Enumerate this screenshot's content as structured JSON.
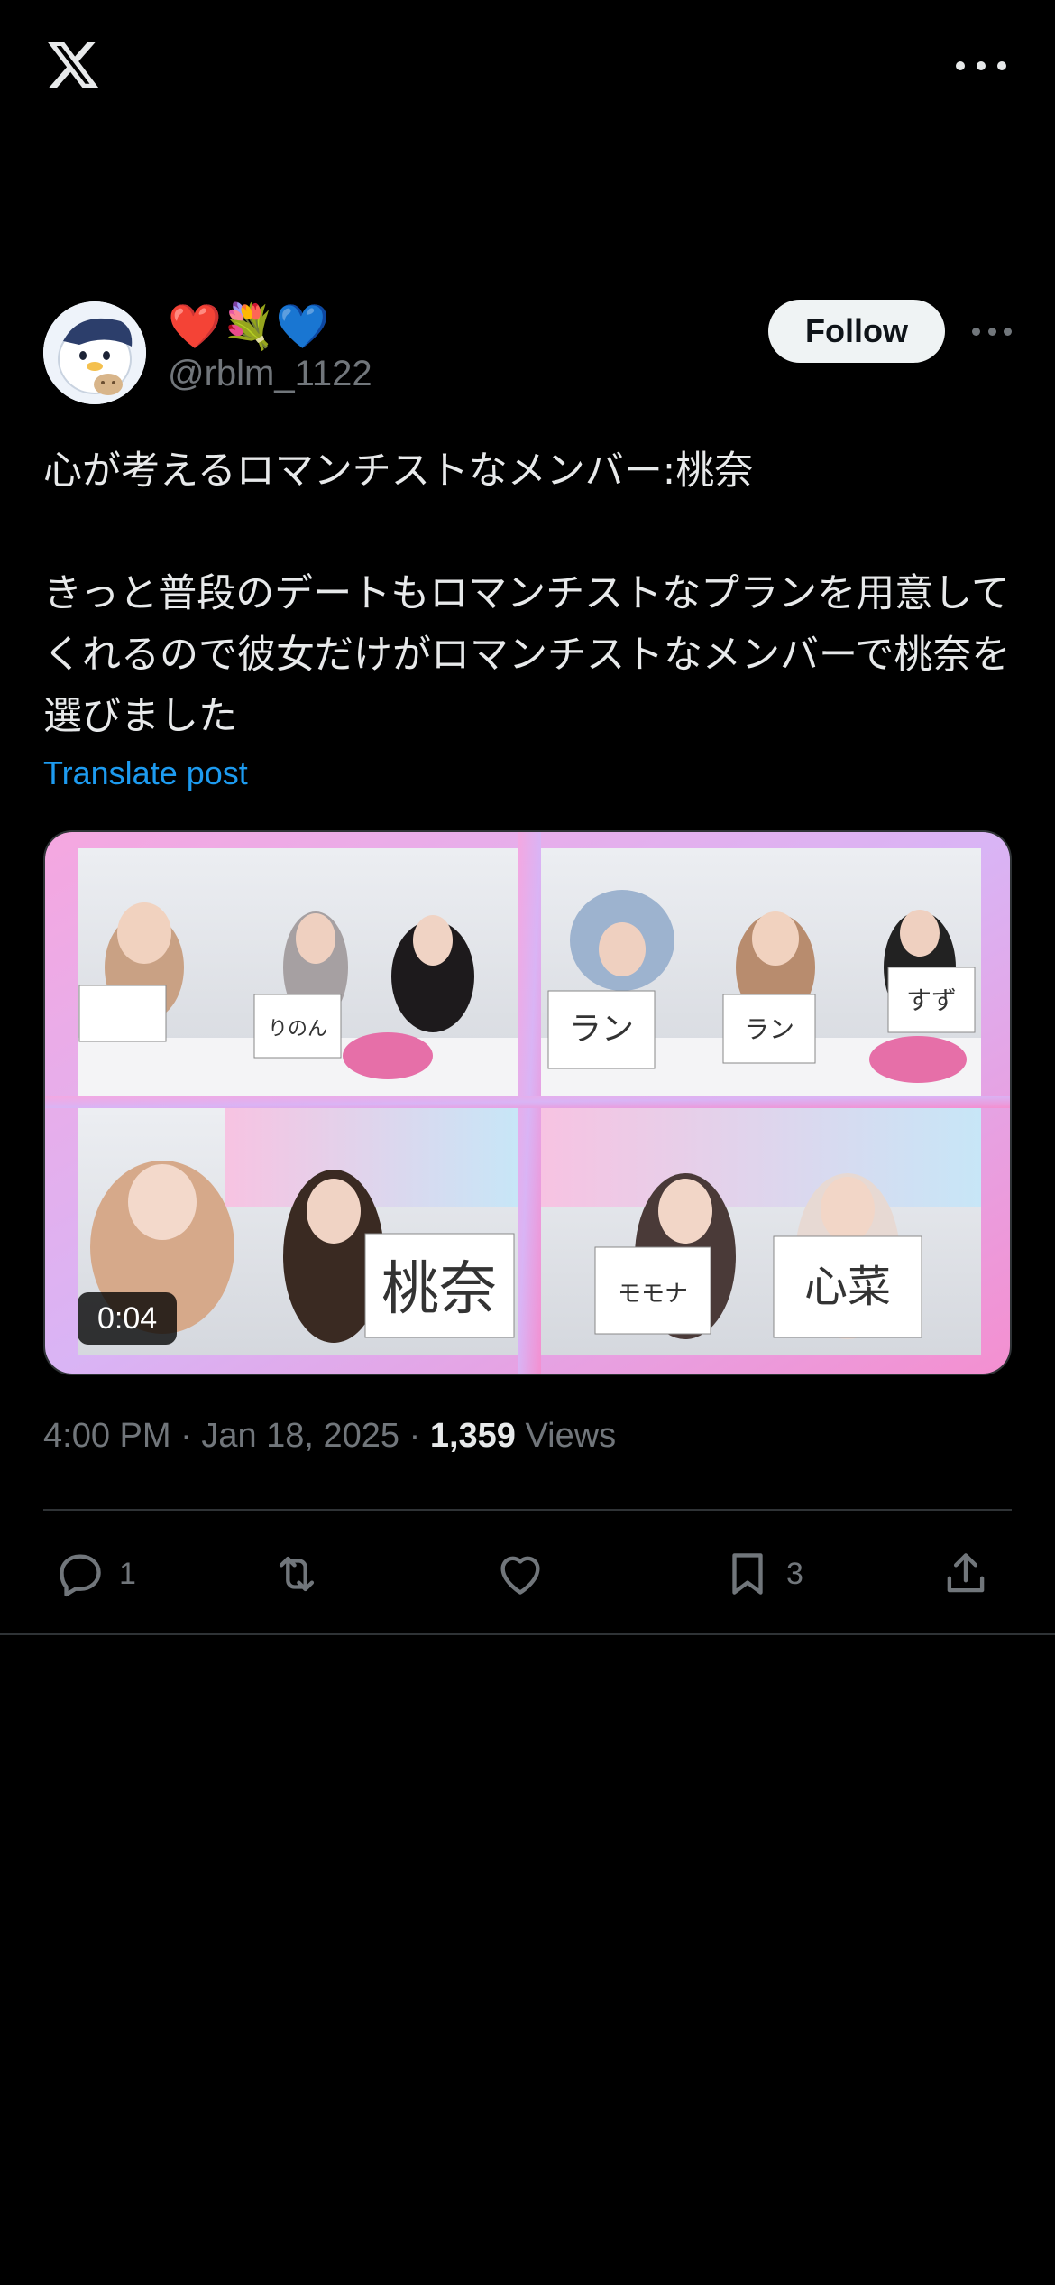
{
  "header": {
    "logo_icon": "x-logo-icon",
    "more_icon": "more-horizontal-icon"
  },
  "author": {
    "display_name_emoji": "❤️💐💙",
    "handle": "@rblm_1122",
    "follow_label": "Follow",
    "avatar_icon": "avatar-character-icon"
  },
  "post": {
    "text": "心が考えるロマンチストなメンバー:桃奈\n\nきっと普段のデートもロマンチストなプランを用意してくれるので彼女だけがロマンチストなメンバーで桃奈を選びました",
    "translate_label": "Translate post"
  },
  "media": {
    "duration": "0:04",
    "card_labels": [
      "りのん",
      "ラン",
      "ラン",
      "すず",
      "桃奈",
      "モモナ",
      "心菜"
    ]
  },
  "meta": {
    "time": "4:00 PM",
    "date": "Jan 18, 2025",
    "separator": "·",
    "views_count": "1,359",
    "views_label": "Views"
  },
  "actions": {
    "reply_count": "1",
    "repost_count": "",
    "like_count": "",
    "bookmark_count": "3"
  },
  "colors": {
    "background": "#000000",
    "text": "#e7e9ea",
    "muted": "#71767b",
    "accent": "#1d9bf0",
    "divider": "#2f3336"
  }
}
